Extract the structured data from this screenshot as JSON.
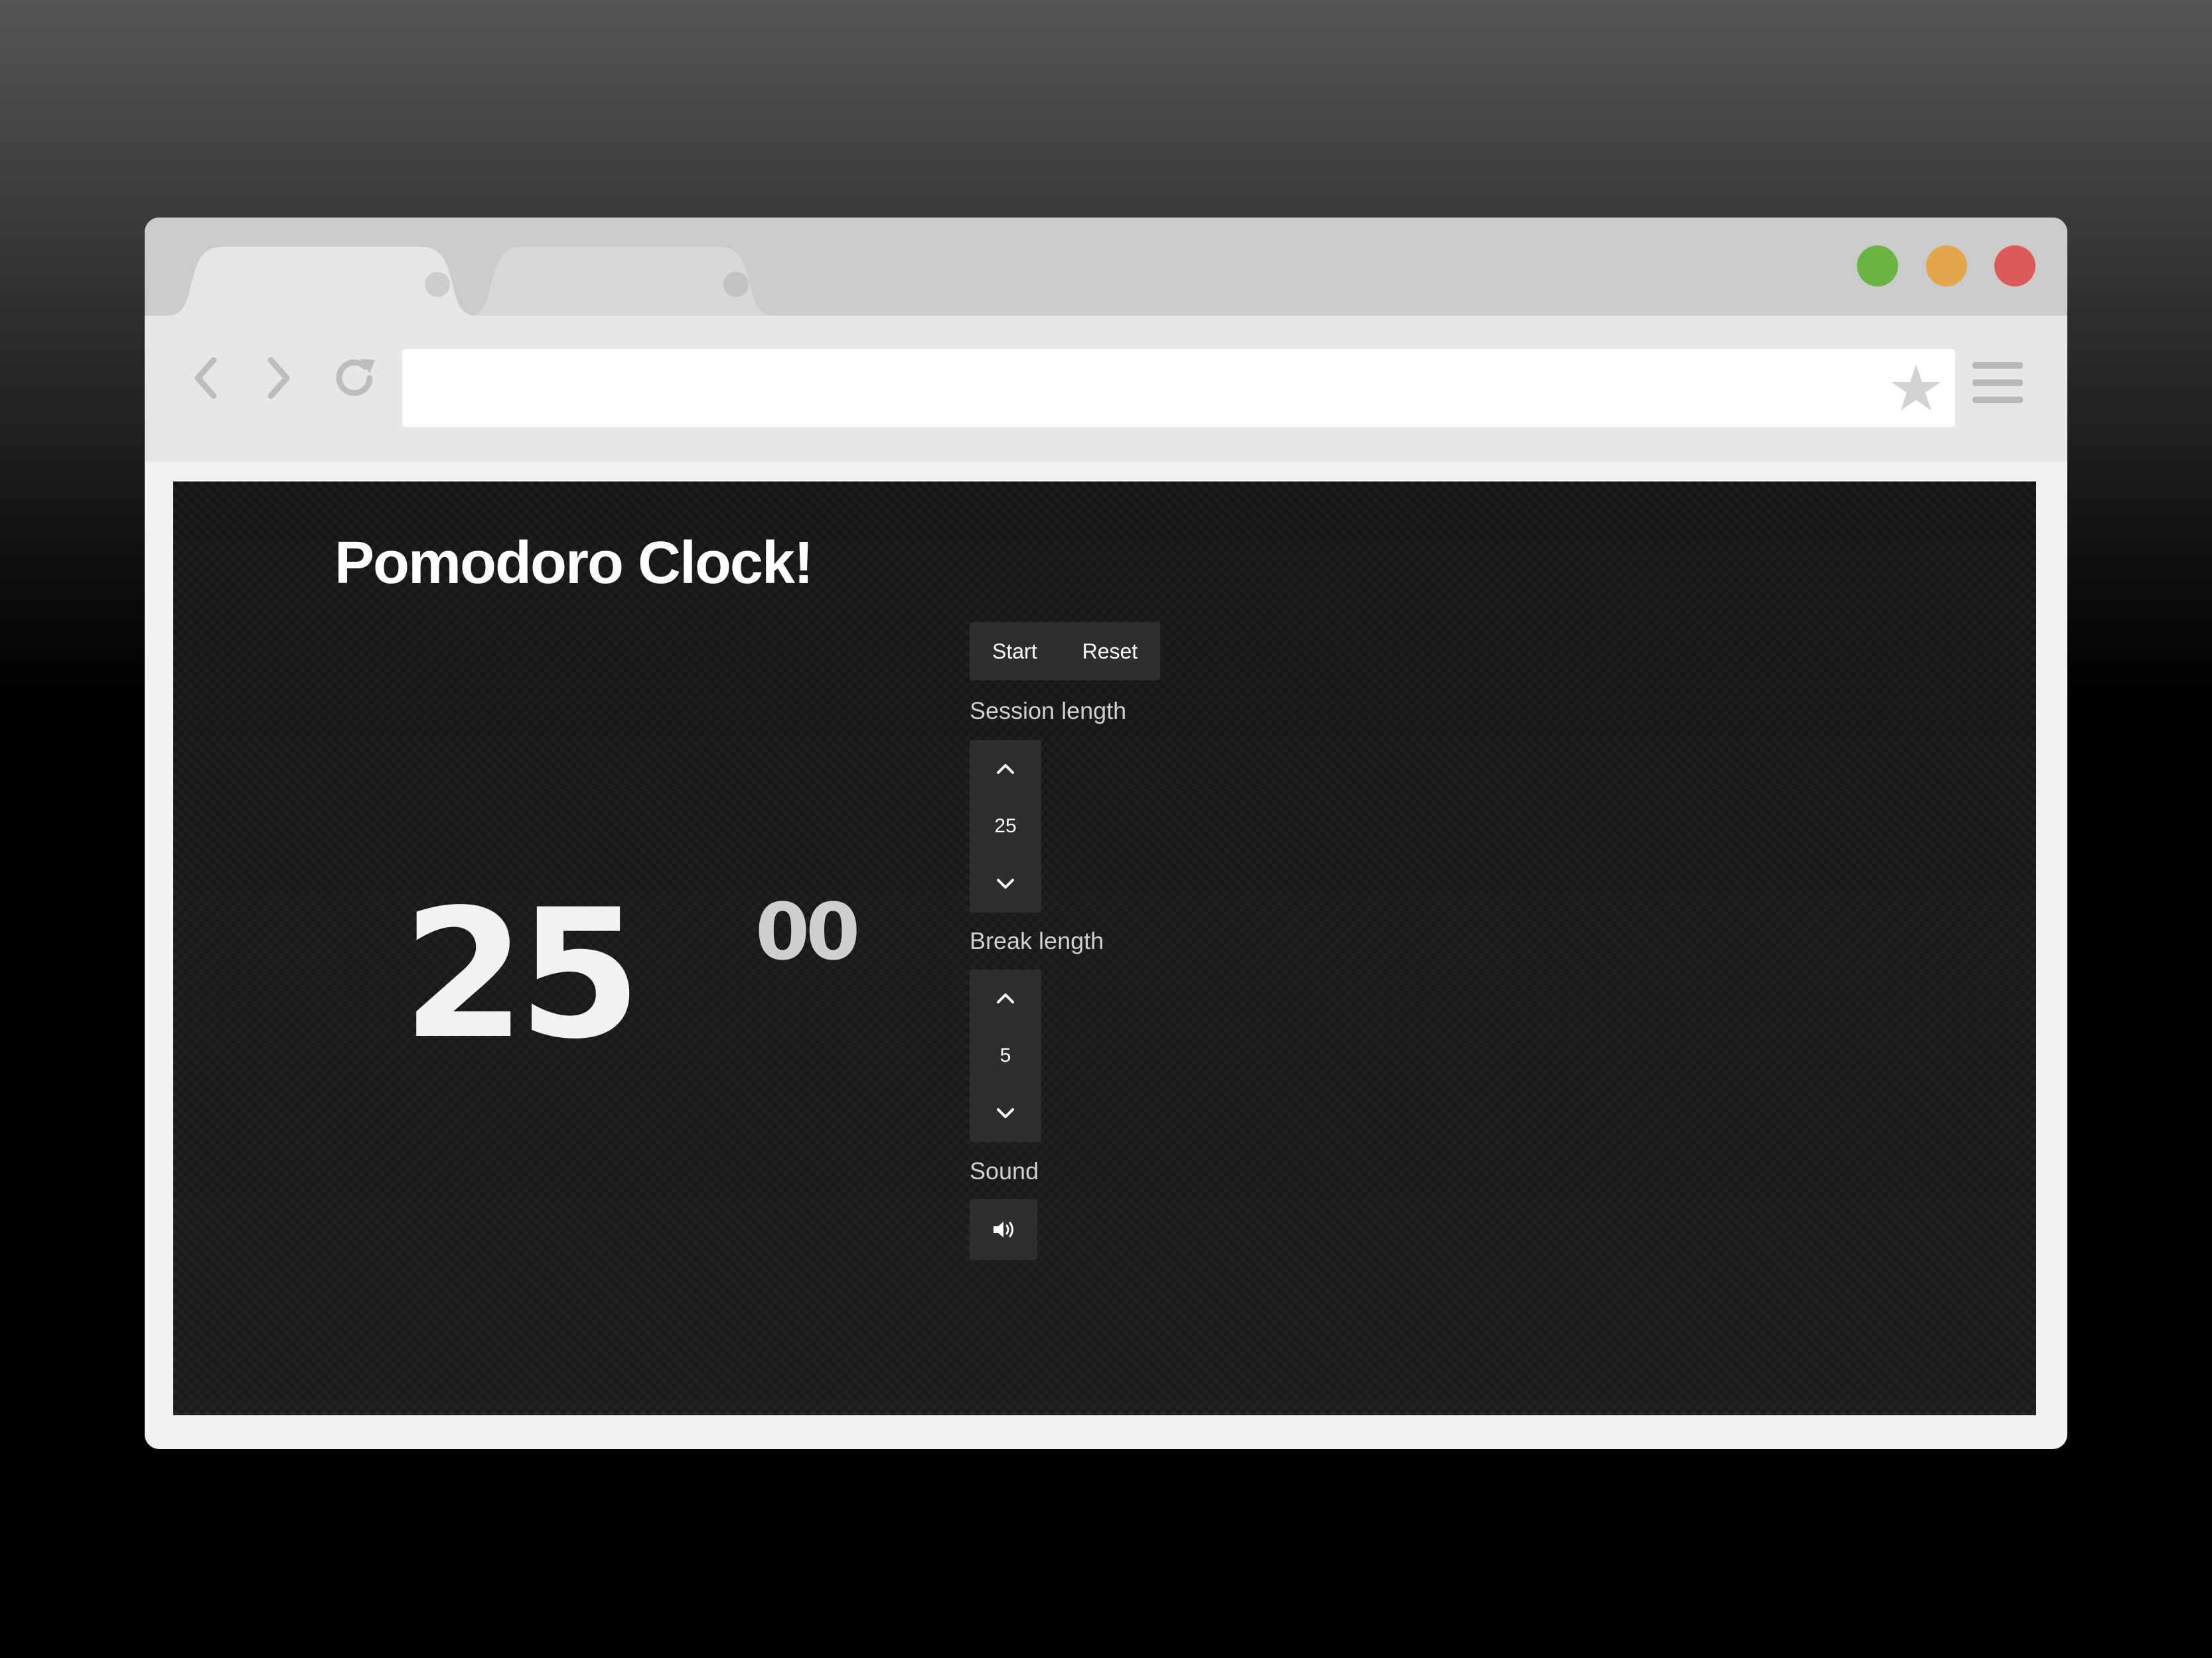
{
  "browser": {
    "tabs": [
      {
        "label": "",
        "active": true
      },
      {
        "label": "",
        "active": false
      }
    ],
    "window_controls": {
      "green": "#6ab443",
      "yellow": "#e2a64c",
      "red": "#de5a58"
    },
    "address_bar": {
      "value": ""
    }
  },
  "app": {
    "title": "Pomodoro Clock!",
    "timer": {
      "minutes": "25",
      "seconds": "00"
    },
    "controls": {
      "start_label": "Start",
      "reset_label": "Reset"
    },
    "session": {
      "label": "Session length",
      "value": "25"
    },
    "break": {
      "label": "Break length",
      "value": "5"
    },
    "sound": {
      "label": "Sound",
      "icon": "volume-icon"
    }
  }
}
